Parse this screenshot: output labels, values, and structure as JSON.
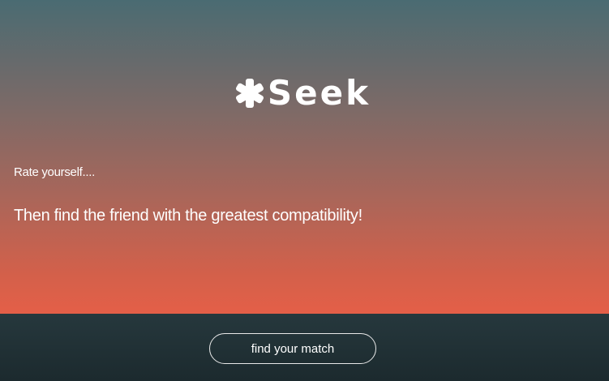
{
  "brand": {
    "logo_icon": "asterisk-icon",
    "name": "Seek"
  },
  "hero": {
    "subtitle": "Rate yourself....",
    "headline": "Then find the friend with the greatest compatibility!"
  },
  "footer": {
    "cta_label": "find your match"
  },
  "colors": {
    "gradient_top": "#4a6b72",
    "gradient_bottom": "#e45f48",
    "footer_bg": "#1f2e32",
    "text": "#ffffff"
  }
}
